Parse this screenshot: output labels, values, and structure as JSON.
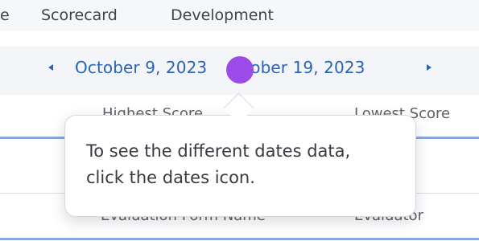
{
  "nav": {
    "tabs": [
      {
        "label": "e"
      },
      {
        "label": "Scorecard"
      },
      {
        "label": "Development"
      }
    ]
  },
  "date_range": {
    "start": "October 9, 2023",
    "end": "ctober 19, 2023"
  },
  "table": {
    "headers": {
      "highest_score": "Highest Score",
      "lowest_score": "Lowest Score"
    },
    "row_labels": {
      "evaluation_form_name": "Evaluation Form Name",
      "evaluator": "Evaluator"
    }
  },
  "tooltip": {
    "text": "To see the different dates data, click the dates icon."
  },
  "colors": {
    "accent": "#2a64b8",
    "highlight_dot": "#9c4be8",
    "divider": "#8aa7de"
  },
  "icons": {
    "previous": "chevron-left-icon",
    "next": "chevron-right-icon"
  }
}
